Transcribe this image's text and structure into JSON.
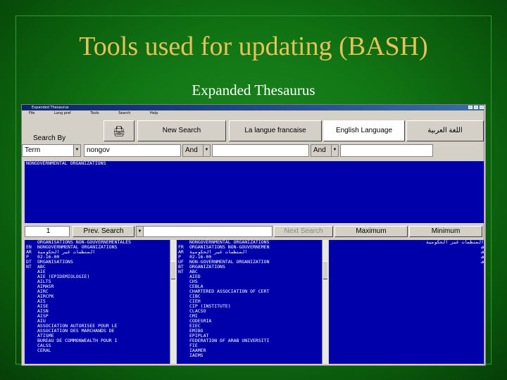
{
  "slide": {
    "title": "Tools used for updating (BASH)",
    "subtitle": "Expanded Thesaurus"
  },
  "window": {
    "title": "Expanded Thesaurus",
    "menu": [
      "File",
      "Lang pref",
      "Tools",
      "Search",
      "Help"
    ]
  },
  "toolbar": {
    "search_by_label": "Search By",
    "print_icon": "printer-icon",
    "new_search_label": "New Search",
    "lang_fr": "La langue francaise",
    "lang_en": "English Language",
    "lang_ar": "اللغة العربية"
  },
  "search_row": {
    "field_type": "Term",
    "query": "nongov",
    "op1": "And",
    "field2": "",
    "op2": "And",
    "field3": ""
  },
  "results_header": "NONGOVERNMENTAL ORGANIZATIONS",
  "nav_bar": {
    "page_number": "1",
    "prev_label": "Prev. Search",
    "next_label": "Next Search",
    "maximum_label": "Maximum",
    "minimum_label": "Minimum"
  },
  "panel_left": [
    {
      "code": "",
      "text": "ORGANISATIONS NON-GOUVERNEMENTALES"
    },
    {
      "code": "EN",
      "text": "NONGOVERNMENTAL ORGANIZATIONS"
    },
    {
      "code": "AR",
      "text": "المنظمات غير الحكومية"
    },
    {
      "code": "P",
      "text": "02-16-00"
    },
    {
      "code": "DT",
      "text": "ORGANISATIONS"
    },
    {
      "code": "NT",
      "text": "ABC"
    },
    {
      "code": "",
      "text": "AIE"
    },
    {
      "code": "",
      "text": "AIE (EPIDEMIOLOGIE)"
    },
    {
      "code": "",
      "text": "AILTS"
    },
    {
      "code": "",
      "text": "AIMASR"
    },
    {
      "code": "",
      "text": "AIRC"
    },
    {
      "code": "",
      "text": "AIRCPK"
    },
    {
      "code": "",
      "text": "AIS"
    },
    {
      "code": "",
      "text": "AISE"
    },
    {
      "code": "",
      "text": "AISN"
    },
    {
      "code": "",
      "text": "AISP"
    },
    {
      "code": "",
      "text": "AIU"
    },
    {
      "code": "",
      "text": "ASSOCIATION AUTORISEE POUR LE"
    },
    {
      "code": "",
      "text": "ASSOCIATION DES MARCHANDS DE"
    },
    {
      "code": "",
      "text": "ATISME"
    },
    {
      "code": "",
      "text": "BUREAU DE COMMONWEALTH POUR I"
    },
    {
      "code": "",
      "text": "CALSS"
    },
    {
      "code": "",
      "text": "CERAL"
    }
  ],
  "panel_middle": [
    {
      "code": "",
      "text": "NONGOVERNMENTAL ORGANIZATIONS"
    },
    {
      "code": "FR",
      "text": "ORGANISATIONS NON-GOUVERNEMEN"
    },
    {
      "code": "AR",
      "text": "المنظمات غير الحكومية"
    },
    {
      "code": "P",
      "text": "02-16-00"
    },
    {
      "code": "UF",
      "text": "NON-GOVERNMENTAL ORGANIZATION"
    },
    {
      "code": "BT",
      "text": "ORGANIZATIONS"
    },
    {
      "code": "NT",
      "text": "ABC"
    },
    {
      "code": "",
      "text": "AIED"
    },
    {
      "code": "",
      "text": "CHS"
    },
    {
      "code": "",
      "text": "CEBLA"
    },
    {
      "code": "",
      "text": "CHARTERED ASSOCIATION OF CERT"
    },
    {
      "code": "",
      "text": "CIBC"
    },
    {
      "code": "",
      "text": "CIEH"
    },
    {
      "code": "",
      "text": "CIP (INSTITUTE)"
    },
    {
      "code": "",
      "text": "CLACSO"
    },
    {
      "code": "",
      "text": "CMI"
    },
    {
      "code": "",
      "text": "CODESRIA"
    },
    {
      "code": "",
      "text": "EIEC"
    },
    {
      "code": "",
      "text": "EMIBO"
    },
    {
      "code": "",
      "text": "EPIPLAT"
    },
    {
      "code": "",
      "text": "FEDERATION OF ARAB UNIVERSITI"
    },
    {
      "code": "",
      "text": "FIE"
    },
    {
      "code": "",
      "text": "IAAMER"
    },
    {
      "code": "",
      "text": "IAEMS"
    }
  ],
  "panel_right": [
    {
      "text": "المنظمات غير الحكومية"
    },
    {
      "text": "ف"
    },
    {
      "text": "ف"
    },
    {
      "text": "ف"
    },
    {
      "text": "ف"
    }
  ],
  "colors": {
    "slide_bg": "#117514",
    "title_color": "#e8c15a",
    "panel_bg": "#0000aa",
    "window_bg": "#d4d0c8"
  }
}
